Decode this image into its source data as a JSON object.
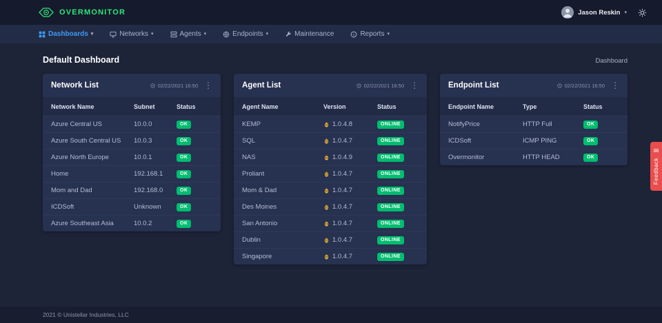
{
  "icons": {
    "caret": "▾",
    "kebab": "⋮",
    "envelope": "✉"
  },
  "colors": {
    "accent_green": "#2ee57a",
    "active_nav_blue": "#3e9bf4",
    "badge_green": "#00bd6f",
    "feedback_red": "#ea4d4d"
  },
  "header": {
    "brand": "OVERMONITOR",
    "user_name": "Jason Reskin"
  },
  "nav": {
    "items": [
      {
        "label": "Dashboards"
      },
      {
        "label": "Networks"
      },
      {
        "label": "Agents"
      },
      {
        "label": "Endpoints"
      },
      {
        "label": "Maintenance"
      },
      {
        "label": "Reports"
      }
    ]
  },
  "page": {
    "title": "Default Dashboard",
    "breadcrumb": "Dashboard"
  },
  "cards": {
    "network": {
      "title": "Network List",
      "timestamp": "02/22/2021 16:50",
      "columns": [
        "Network Name",
        "Subnet",
        "Status"
      ],
      "rows": [
        {
          "name": "Azure Central US",
          "subnet": "10.0.0",
          "status": "OK"
        },
        {
          "name": "Azure South Central US",
          "subnet": "10.0.3",
          "status": "OK"
        },
        {
          "name": "Azure North Europe",
          "subnet": "10.0.1",
          "status": "OK"
        },
        {
          "name": "Home",
          "subnet": "192.168.1",
          "status": "OK"
        },
        {
          "name": "Mom and Dad",
          "subnet": "192.168.0",
          "status": "OK"
        },
        {
          "name": "ICDSoft",
          "subnet": "Unknown",
          "status": "OK"
        },
        {
          "name": "Azure Southeast Asia",
          "subnet": "10.0.2",
          "status": "OK"
        }
      ]
    },
    "agent": {
      "title": "Agent List",
      "timestamp": "02/22/2021 16:50",
      "columns": [
        "Agent Name",
        "Version",
        "Status"
      ],
      "rows": [
        {
          "name": "KEMP",
          "version": "1.0.4.8",
          "status": "ONLINE"
        },
        {
          "name": "SQL",
          "version": "1.0.4.7",
          "status": "ONLINE"
        },
        {
          "name": "NAS",
          "version": "1.0.4.9",
          "status": "ONLINE"
        },
        {
          "name": "Proliant",
          "version": "1.0.4.7",
          "status": "ONLINE"
        },
        {
          "name": "Mom & Dad",
          "version": "1.0.4.7",
          "status": "ONLINE"
        },
        {
          "name": "Des Moines",
          "version": "1.0.4.7",
          "status": "ONLINE"
        },
        {
          "name": "San Antonio",
          "version": "1.0.4.7",
          "status": "ONLINE"
        },
        {
          "name": "Dublin",
          "version": "1.0.4.7",
          "status": "ONLINE"
        },
        {
          "name": "Singapore",
          "version": "1.0.4.7",
          "status": "ONLINE"
        }
      ]
    },
    "endpoint": {
      "title": "Endpoint List",
      "timestamp": "02/22/2021 16:50",
      "columns": [
        "Endpoint Name",
        "Type",
        "Status"
      ],
      "rows": [
        {
          "name": "NotifyPrice",
          "type": "HTTP Full",
          "status": "OK"
        },
        {
          "name": "ICDSoft",
          "type": "ICMP PING",
          "status": "OK"
        },
        {
          "name": "Overmonitor",
          "type": "HTTP HEAD",
          "status": "OK"
        }
      ]
    }
  },
  "feedback": {
    "label": "Feedback"
  },
  "footer": {
    "text": "2021 © Unistellar Industries, LLC"
  }
}
